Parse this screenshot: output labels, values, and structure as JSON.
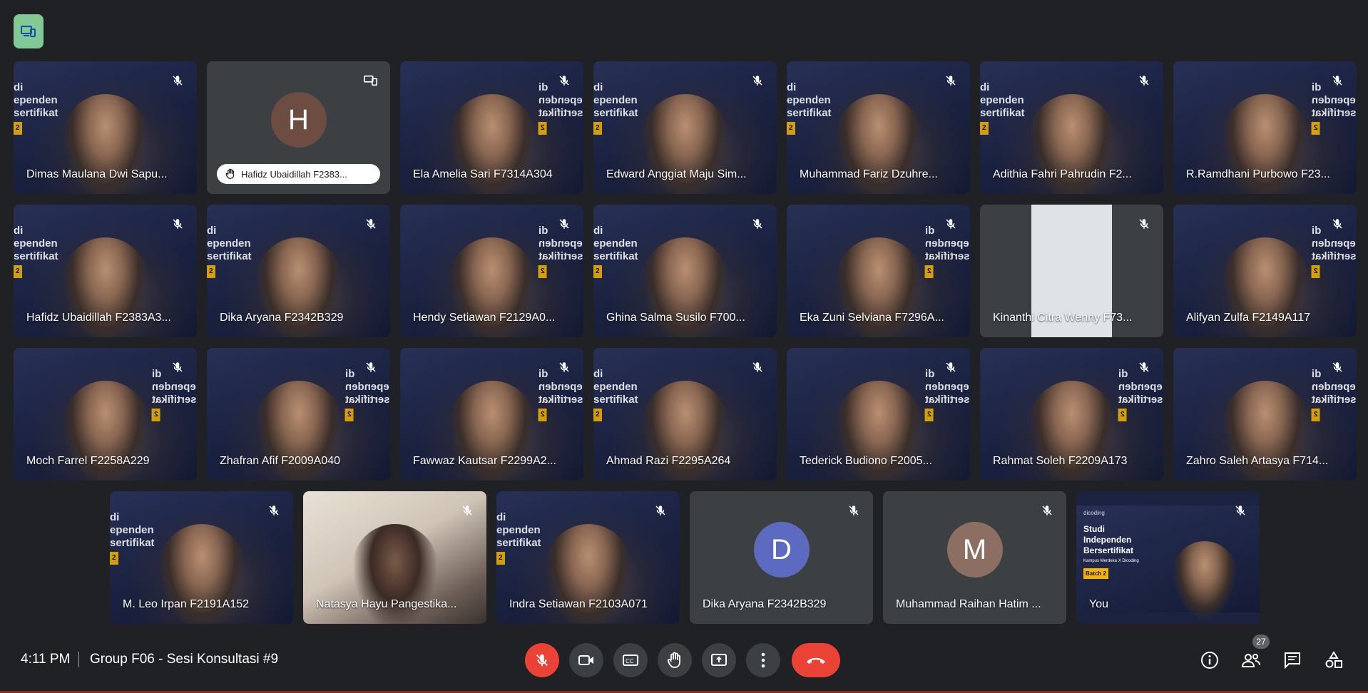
{
  "promo": {
    "line1": "di",
    "line2": "ependen",
    "line3": "sertifikat",
    "sub": "Merdeka X Dicoding",
    "batch": "2"
  },
  "self_banner": {
    "brand": "dicoding",
    "line1": "Studi",
    "line2": "Independen",
    "line3": "Bersertifikat",
    "sub": "Kampus Merdeka X Dicoding",
    "batch": "Batch 2"
  },
  "rows": [
    [
      {
        "name": "Dimas Maulana Dwi Sapu...",
        "kind": "video",
        "promo": "left"
      },
      {
        "name": "Hafidz Ubaidillah F2383...",
        "kind": "avatar",
        "initial": "H",
        "color": "#6d4c41",
        "pinned": true
      },
      {
        "name": "Ela Amelia Sari F7314A304",
        "kind": "video",
        "promo": "right"
      },
      {
        "name": "Edward Anggiat Maju Sim...",
        "kind": "video",
        "promo": "left"
      },
      {
        "name": "Muhammad Fariz Dzuhre...",
        "kind": "video",
        "promo": "left"
      },
      {
        "name": "Adithia Fahri Pahrudin F2...",
        "kind": "video",
        "promo": "left"
      },
      {
        "name": "R.Ramdhani Purbowo F23...",
        "kind": "video",
        "promo": "right"
      }
    ],
    [
      {
        "name": "Hafidz Ubaidillah F2383A3...",
        "kind": "video",
        "promo": "left"
      },
      {
        "name": "Dika Aryana F2342B329",
        "kind": "video",
        "promo": "left"
      },
      {
        "name": "Hendy Setiawan F2129A0...",
        "kind": "video",
        "promo": "right"
      },
      {
        "name": "Ghina Salma Susilo F700...",
        "kind": "video",
        "promo": "left"
      },
      {
        "name": "Eka Zuni Selviana F7296A...",
        "kind": "video",
        "promo": "right"
      },
      {
        "name": "Kinanthi Citra Wenny F73...",
        "kind": "camera"
      },
      {
        "name": "Alifyan Zulfa F2149A117",
        "kind": "video",
        "promo": "right"
      }
    ],
    [
      {
        "name": "Moch Farrel F2258A229",
        "kind": "video",
        "promo": "right"
      },
      {
        "name": "Zhafran Afif F2009A040",
        "kind": "video",
        "promo": "right"
      },
      {
        "name": "Fawwaz Kautsar F2299A2...",
        "kind": "video",
        "promo": "right"
      },
      {
        "name": "Ahmad Razi F2295A264",
        "kind": "video",
        "promo": "left"
      },
      {
        "name": "Tederick Budiono F2005...",
        "kind": "video",
        "promo": "right"
      },
      {
        "name": "Rahmat Soleh F2209A173",
        "kind": "video",
        "promo": "right"
      },
      {
        "name": "Zahro Saleh Artasya F714...",
        "kind": "video",
        "promo": "right"
      }
    ],
    [
      {
        "name": "M. Leo Irpan F2191A152",
        "kind": "video",
        "promo": "left"
      },
      {
        "name": "Natasya Hayu Pangestika...",
        "kind": "light"
      },
      {
        "name": "Indra Setiawan F2103A071",
        "kind": "video",
        "promo": "left"
      },
      {
        "name": "Dika Aryana F2342B329",
        "kind": "avatar",
        "initial": "D",
        "color": "#5c6bc0"
      },
      {
        "name": "Muhammad Raihan Hatim ...",
        "kind": "avatar",
        "initial": "M",
        "color": "#8d6e63"
      },
      {
        "name": "You",
        "kind": "self"
      }
    ]
  ],
  "bottom_bar": {
    "time": "4:11 PM",
    "meeting_title": "Group F06 - Sesi Konsultasi #9",
    "participant_count": "27"
  }
}
